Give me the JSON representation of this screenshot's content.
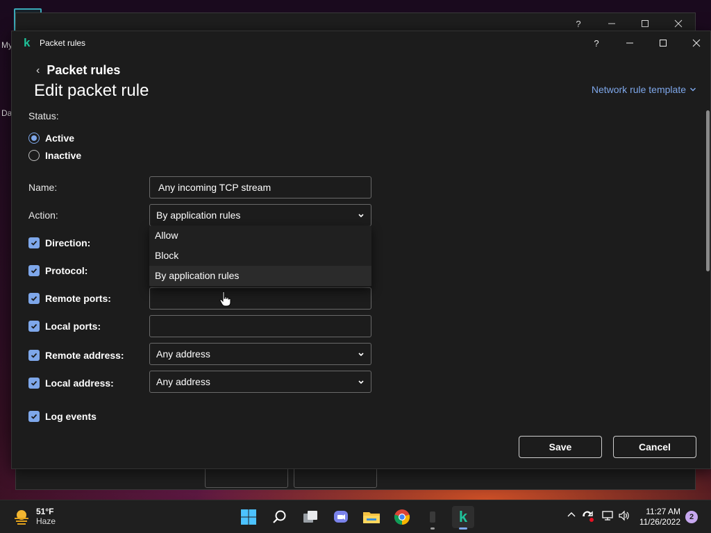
{
  "window": {
    "title": "Packet rules",
    "help_label": "?"
  },
  "parent_window": {
    "help_label": "?",
    "desktop_text_a": "My",
    "desktop_text_b": "Da"
  },
  "header": {
    "breadcrumb": "Packet rules",
    "page_title": "Edit packet rule",
    "template_link": "Network rule template"
  },
  "status": {
    "label": "Status:",
    "options": [
      {
        "label": "Active",
        "selected": true
      },
      {
        "label": "Inactive",
        "selected": false
      }
    ]
  },
  "fields": {
    "name": {
      "label": "Name:",
      "value": "Any incoming TCP stream"
    },
    "action": {
      "label": "Action:",
      "value": "By application rules",
      "options": [
        "Allow",
        "Block",
        "By application rules"
      ]
    },
    "direction": {
      "label": "Direction:",
      "checked": true
    },
    "protocol": {
      "label": "Protocol:",
      "checked": true
    },
    "remote_ports": {
      "label": "Remote ports:",
      "checked": true,
      "value": ""
    },
    "local_ports": {
      "label": "Local ports:",
      "checked": true,
      "value": ""
    },
    "remote_address": {
      "label": "Remote address:",
      "checked": true,
      "value": "Any address"
    },
    "local_address": {
      "label": "Local address:",
      "checked": true,
      "value": "Any address"
    },
    "log_events": {
      "label": "Log events",
      "checked": true
    }
  },
  "buttons": {
    "save": "Save",
    "cancel": "Cancel"
  },
  "taskbar": {
    "weather": {
      "temp": "51°F",
      "condition": "Haze"
    },
    "clock": {
      "time": "11:27 AM",
      "date": "11/26/2022"
    },
    "notification_count": "2",
    "apps": [
      "windows-start",
      "search",
      "task-view",
      "teams-chat",
      "file-explorer",
      "chrome",
      "unknown-app",
      "kaspersky"
    ]
  },
  "colors": {
    "accent": "#7ea7ea",
    "dialog_bg": "#1c1c1c",
    "logo": "#1fc29a"
  }
}
